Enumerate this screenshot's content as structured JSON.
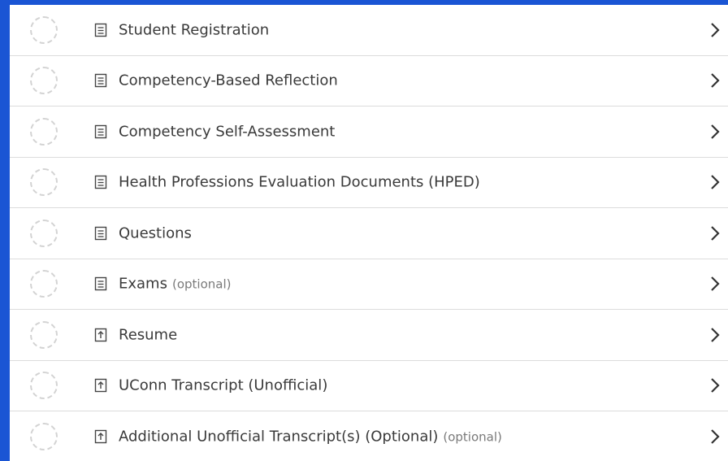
{
  "items": [
    {
      "label": "Student Registration",
      "icon": "document-icon",
      "optional": ""
    },
    {
      "label": "Competency-Based Reflection",
      "icon": "document-icon",
      "optional": ""
    },
    {
      "label": "Competency Self-Assessment",
      "icon": "document-icon",
      "optional": ""
    },
    {
      "label": "Health Professions Evaluation Documents (HPED)",
      "icon": "document-icon",
      "optional": ""
    },
    {
      "label": "Questions",
      "icon": "document-icon",
      "optional": ""
    },
    {
      "label": "Exams",
      "icon": "document-icon",
      "optional": "(optional)"
    },
    {
      "label": "Resume",
      "icon": "upload-icon",
      "optional": ""
    },
    {
      "label": "UConn Transcript (Unofficial)",
      "icon": "upload-icon",
      "optional": ""
    },
    {
      "label": "Additional Unofficial Transcript(s) (Optional)",
      "icon": "upload-icon",
      "optional": "(optional)"
    }
  ],
  "colors": {
    "frame": "#1a55d4",
    "text": "#3a3a3a",
    "muted": "#7a7a7a",
    "divider": "#dcdcdc"
  }
}
